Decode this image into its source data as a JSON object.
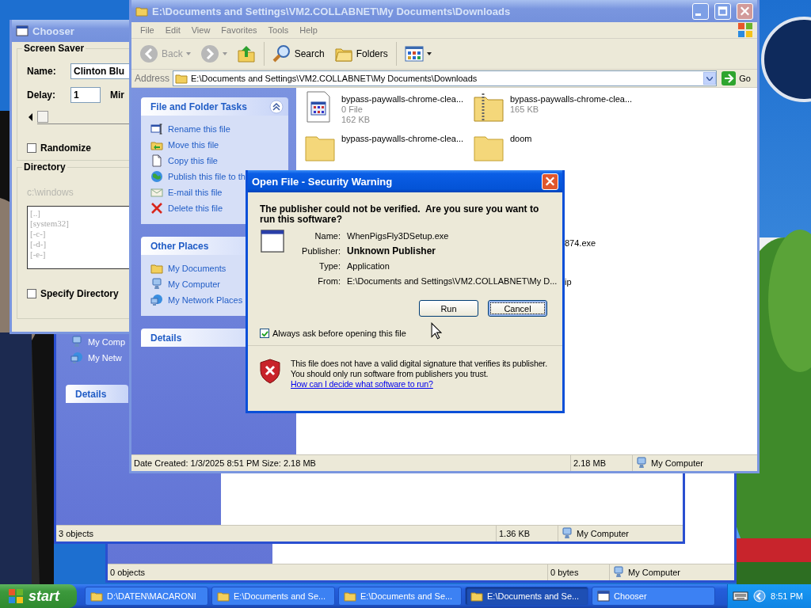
{
  "back_windows": [
    {
      "status": [
        "0 objects",
        "0 bytes",
        "My Computer"
      ]
    },
    {
      "panel_items": [
        {
          "kind": "computer",
          "label": "My Comp"
        },
        {
          "kind": "network",
          "label": "My Netw"
        }
      ],
      "details": "Details",
      "status": [
        "3 objects",
        "1.36 KB",
        "My Computer"
      ]
    }
  ],
  "chooser": {
    "title": "Chooser",
    "screen_saver": {
      "title": "Screen Saver",
      "name_label": "Name:",
      "name_value": "Clinton Blu",
      "delay_label": "Delay:",
      "delay_value": "1",
      "unit": "Mir",
      "level": 0,
      "randomize": {
        "label": "Randomize",
        "checked": false
      }
    },
    "directory": {
      "title": "Directory",
      "disabled": true,
      "path": "c:\\windows",
      "entries": [
        "[..]",
        "[system32]",
        "[-c-]",
        "[-d-]",
        "[-e-]"
      ],
      "specify": {
        "label": "Specify Directory",
        "checked": false
      }
    }
  },
  "explorer": {
    "title": "E:\\Documents and Settings\\VM2.COLLABNET\\My Documents\\Downloads",
    "menu": [
      "File",
      "Edit",
      "View",
      "Favorites",
      "Tools",
      "Help"
    ],
    "toolbar": [
      {
        "kind": "back",
        "label": "Back",
        "disabled": true
      },
      {
        "kind": "forward",
        "disabled": true
      },
      {
        "kind": "up"
      },
      {
        "kind": "search",
        "label": "Search"
      },
      {
        "kind": "folders",
        "label": "Folders"
      },
      {
        "kind": "views"
      }
    ],
    "address": {
      "label": "Address",
      "value": "E:\\Documents and Settings\\VM2.COLLABNET\\My Documents\\Downloads",
      "go": "Go"
    },
    "tasks": {
      "title": "File and Folder Tasks",
      "items": [
        {
          "kind": "rename",
          "label": "Rename this file"
        },
        {
          "kind": "move",
          "label": "Move this file"
        },
        {
          "kind": "copy",
          "label": "Copy this file"
        },
        {
          "kind": "publish",
          "label": "Publish this file to th"
        },
        {
          "kind": "email",
          "label": "E-mail this file"
        },
        {
          "kind": "delete",
          "label": "Delete this file"
        }
      ]
    },
    "other_places": {
      "title": "Other Places",
      "items": [
        {
          "kind": "folder",
          "label": "My Documents"
        },
        {
          "kind": "computer",
          "label": "My Computer"
        },
        {
          "kind": "network",
          "label": "My Network Places"
        }
      ]
    },
    "details": {
      "title": "Details"
    },
    "files": [
      {
        "kind": "program",
        "name": "bypass-paywalls-chrome-clea...",
        "lines": [
          "0 File",
          "162 KB"
        ]
      },
      {
        "kind": "archive",
        "name": "bypass-paywalls-chrome-clea...",
        "lines": [
          "165 KB"
        ]
      },
      {
        "kind": "folder",
        "name": "bypass-paywalls-chrome-clea..."
      },
      {
        "kind": "folder",
        "name": "doom"
      }
    ],
    "partial_files": [
      "874.exe",
      "ip"
    ],
    "status": [
      "Date Created: 1/3/2025 8:51 PM Size: 2.18 MB",
      "2.18 MB",
      "My Computer"
    ]
  },
  "dialog": {
    "title": "Open File - Security Warning",
    "question": "The publisher could not be verified.  Are you sure you want to run this software?",
    "fields": [
      {
        "label": "Name:",
        "value": "WhenPigsFly3DSetup.exe",
        "emphasis": false
      },
      {
        "label": "Publisher:",
        "value": "Unknown Publisher",
        "emphasis": true
      },
      {
        "label": "Type:",
        "value": "Application",
        "emphasis": false
      },
      {
        "label": "From:",
        "value": "E:\\Documents and Settings\\VM2.COLLABNET\\My D...",
        "emphasis": false
      }
    ],
    "buttons": [
      {
        "label": "Run",
        "focused": false
      },
      {
        "label": "Cancel",
        "focused": true
      }
    ],
    "always_ask": {
      "label": "Always ask before opening this file",
      "checked": true
    },
    "warning": "This file does not have a valid digital signature that verifies its publisher.  You should only run software from publishers you trust.",
    "link": "How can I decide what software to run?"
  },
  "taskbar": {
    "start": "start",
    "tasks": [
      {
        "kind": "folder",
        "label": "D:\\DATEN\\MACARONI",
        "selected": false
      },
      {
        "kind": "folder",
        "label": "E:\\Documents and Se...",
        "selected": false
      },
      {
        "kind": "folder",
        "label": "E:\\Documents and Se...",
        "selected": false
      },
      {
        "kind": "folder",
        "label": "E:\\Documents and Se...",
        "selected": true
      },
      {
        "kind": "window",
        "label": "Chooser",
        "selected": false
      }
    ],
    "clock": "8:51 PM"
  }
}
